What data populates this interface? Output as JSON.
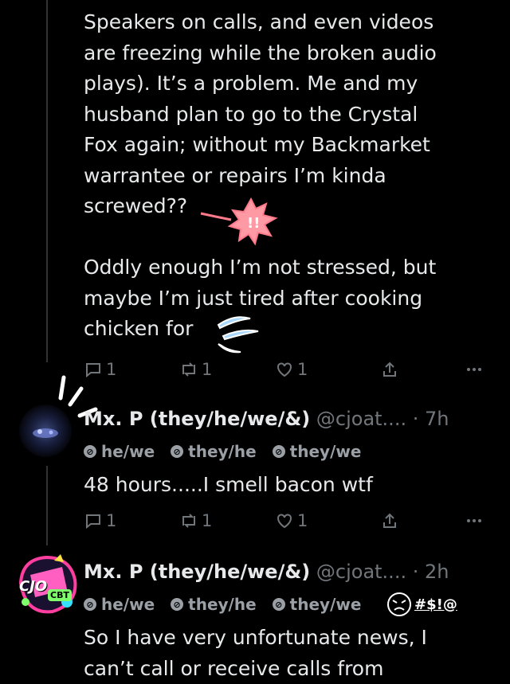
{
  "tweet1": {
    "text": "Speakers on calls, and even videos\nare freezing while the broken audio\nplays). It’s a problem. Me and my\nhusband plan to go to the Crystal\nFox again; without my Backmarket\nwarrantee or repairs I’m kinda\nscrewed??\n\nOddly enough I’m not stressed, but\nmaybe I’m just tired after cooking\nchicken for",
    "replies": "1",
    "retweets": "1",
    "likes": "1"
  },
  "tweet2": {
    "name": "Mx. P (they/he/we/&)",
    "handle": "@cjoat....",
    "time": "· 7h",
    "pronouns": [
      "he/we",
      "they/he",
      "they/we"
    ],
    "text": "48 hours.....I smell bacon wtf",
    "replies": "1",
    "retweets": "1",
    "likes": "1"
  },
  "tweet3": {
    "name": "Mx. P (they/he/we/&)",
    "handle": "@cjoat....",
    "time": "· 2h",
    "pronouns": [
      "he/we",
      "they/he",
      "they/we"
    ],
    "sticker_text": "#$!@",
    "avatar_text": "CJO",
    "avatar_badge": "CBT",
    "text": "So I have very unfortunate news, I\ncan’t call or receive calls from"
  },
  "colors": {
    "background": "#000000",
    "text": "#e7e9ea",
    "muted": "#71767b",
    "accent": "#ff7a8a"
  }
}
